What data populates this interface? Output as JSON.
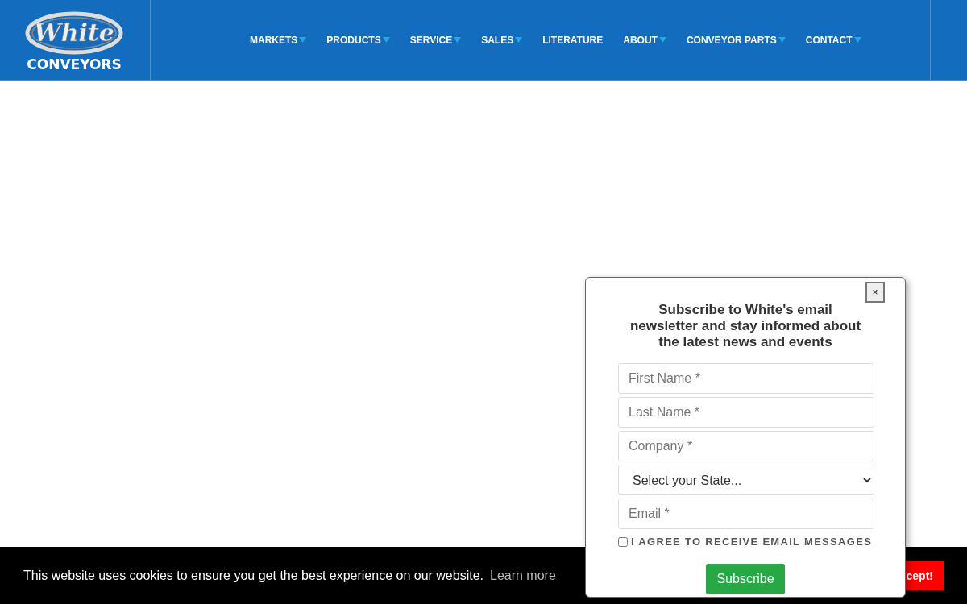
{
  "logo": {
    "script": "White",
    "word": "CONVEYORS"
  },
  "nav": [
    {
      "label": "MARKETS",
      "has_dropdown": true
    },
    {
      "label": "PRODUCTS",
      "has_dropdown": true
    },
    {
      "label": "SERVICE",
      "has_dropdown": true
    },
    {
      "label": "SALES",
      "has_dropdown": true
    },
    {
      "label": "LITERATURE",
      "has_dropdown": false
    },
    {
      "label": "ABOUT",
      "has_dropdown": true
    },
    {
      "label": "CONVEYOR PARTS",
      "has_dropdown": true
    },
    {
      "label": "CONTACT",
      "has_dropdown": true
    }
  ],
  "newsletter_popup": {
    "close": "×",
    "title": "Subscribe to White's email newsletter and stay informed about the latest news and events",
    "fields": [
      {
        "kind": "input",
        "placeholder": "First Name *"
      },
      {
        "kind": "input",
        "placeholder": "Last Name *"
      },
      {
        "kind": "input",
        "placeholder": "Company *"
      },
      {
        "kind": "select",
        "value": "Select your State..."
      },
      {
        "kind": "input",
        "placeholder": "Email *"
      }
    ],
    "consent": {
      "label": "I AGREE TO RECEIVE EMAIL MESSAGES",
      "checked": false
    },
    "submit": "Subscribe"
  },
  "cookie_bar": {
    "message": "This website uses cookies to ensure you get the best experience on our website.",
    "link": "Learn more",
    "accept": "cept!"
  }
}
